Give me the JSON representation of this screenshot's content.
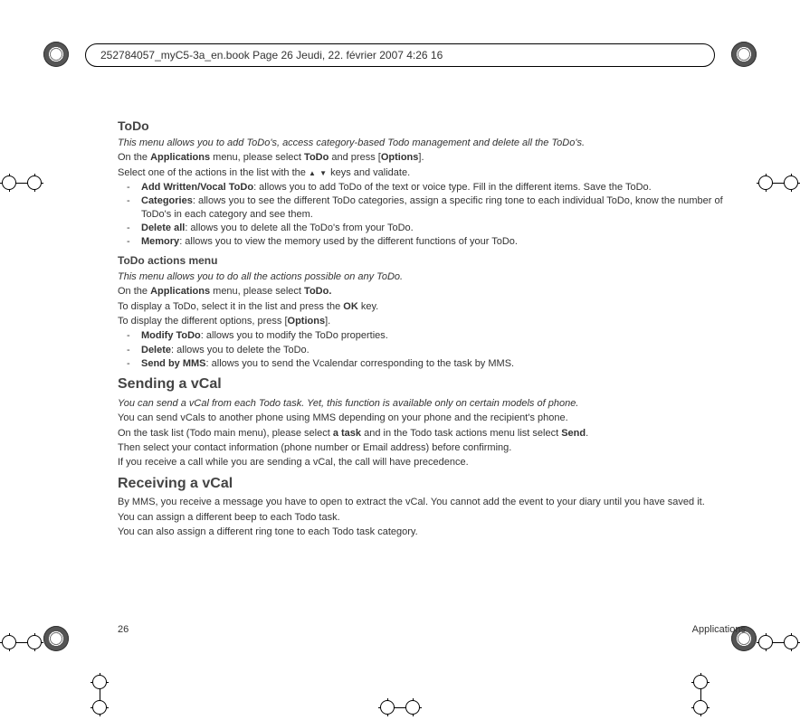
{
  "header": {
    "text": "252784057_myC5-3a_en.book  Page 26  Jeudi, 22. février 2007  4:26 16"
  },
  "footer": {
    "pageNumber": "26",
    "sectionName": "Applications"
  },
  "todo": {
    "heading": "ToDo",
    "intro": "This menu allows you to add ToDo's, access category-based Todo management and delete all the ToDo's.",
    "line1_a": "On the ",
    "line1_b": "Applications",
    "line1_c": " menu, please select ",
    "line1_d": "ToDo",
    "line1_e": " and press [",
    "line1_f": "Options",
    "line1_g": "].",
    "line2_a": "Select one of the actions in the list with the ",
    "line2_b": " keys and validate.",
    "items": [
      {
        "term": "Add Written/Vocal ToDo",
        "desc": ": allows you to add ToDo of the text or voice type. Fill in the different items. Save the ToDo."
      },
      {
        "term": "Categories",
        "desc": ": allows you to see the different ToDo categories, assign a specific ring tone to each individual ToDo, know the number of ToDo's in each category and see them."
      },
      {
        "term": "Delete all",
        "desc": ": allows you to delete all the ToDo's from your ToDo."
      },
      {
        "term": "Memory",
        "desc": ": allows you to view the memory used by the different functions of your ToDo."
      }
    ]
  },
  "actionsMenu": {
    "heading": "ToDo actions menu",
    "intro": "This menu allows you to do all the actions possible on any ToDo.",
    "line1_a": "On the ",
    "line1_b": "Applications",
    "line1_c": " menu, please select ",
    "line1_d": "ToDo.",
    "line2_a": "To display a ToDo, select it in the list and press the ",
    "line2_b": "OK",
    "line2_c": " key.",
    "line3_a": "To display the different options, press [",
    "line3_b": "Options",
    "line3_c": "].",
    "items": [
      {
        "term": "Modify ToDo",
        "desc": ": allows you to modify the ToDo properties."
      },
      {
        "term": "Delete",
        "desc": ": allows you to delete the ToDo."
      },
      {
        "term": "Send by MMS",
        "desc": ": allows you to send the Vcalendar corresponding to the task by MMS."
      }
    ]
  },
  "sending": {
    "heading": "Sending a vCal",
    "intro": "You can send a vCal from each Todo task. Yet, this function is available only on certain models of phone.",
    "p1": "You can send vCals to another phone using MMS depending on your phone and the recipient's phone.",
    "p2_a": "On the task list (Todo main menu), please select ",
    "p2_b": "a task",
    "p2_c": " and in the Todo task actions menu list select ",
    "p2_d": "Send",
    "p2_e": ".",
    "p3": "Then select your contact information (phone number or Email address) before confirming.",
    "p4": "If you receive a call while you are sending a vCal, the call will have precedence."
  },
  "receiving": {
    "heading": "Receiving a vCal",
    "p1": "By MMS, you receive a message you have to open to extract the vCal. You cannot add the event to your diary until you have saved it.",
    "p2": "You can assign a different beep to each Todo task.",
    "p3": "You can also assign a different ring tone to each Todo task category."
  }
}
